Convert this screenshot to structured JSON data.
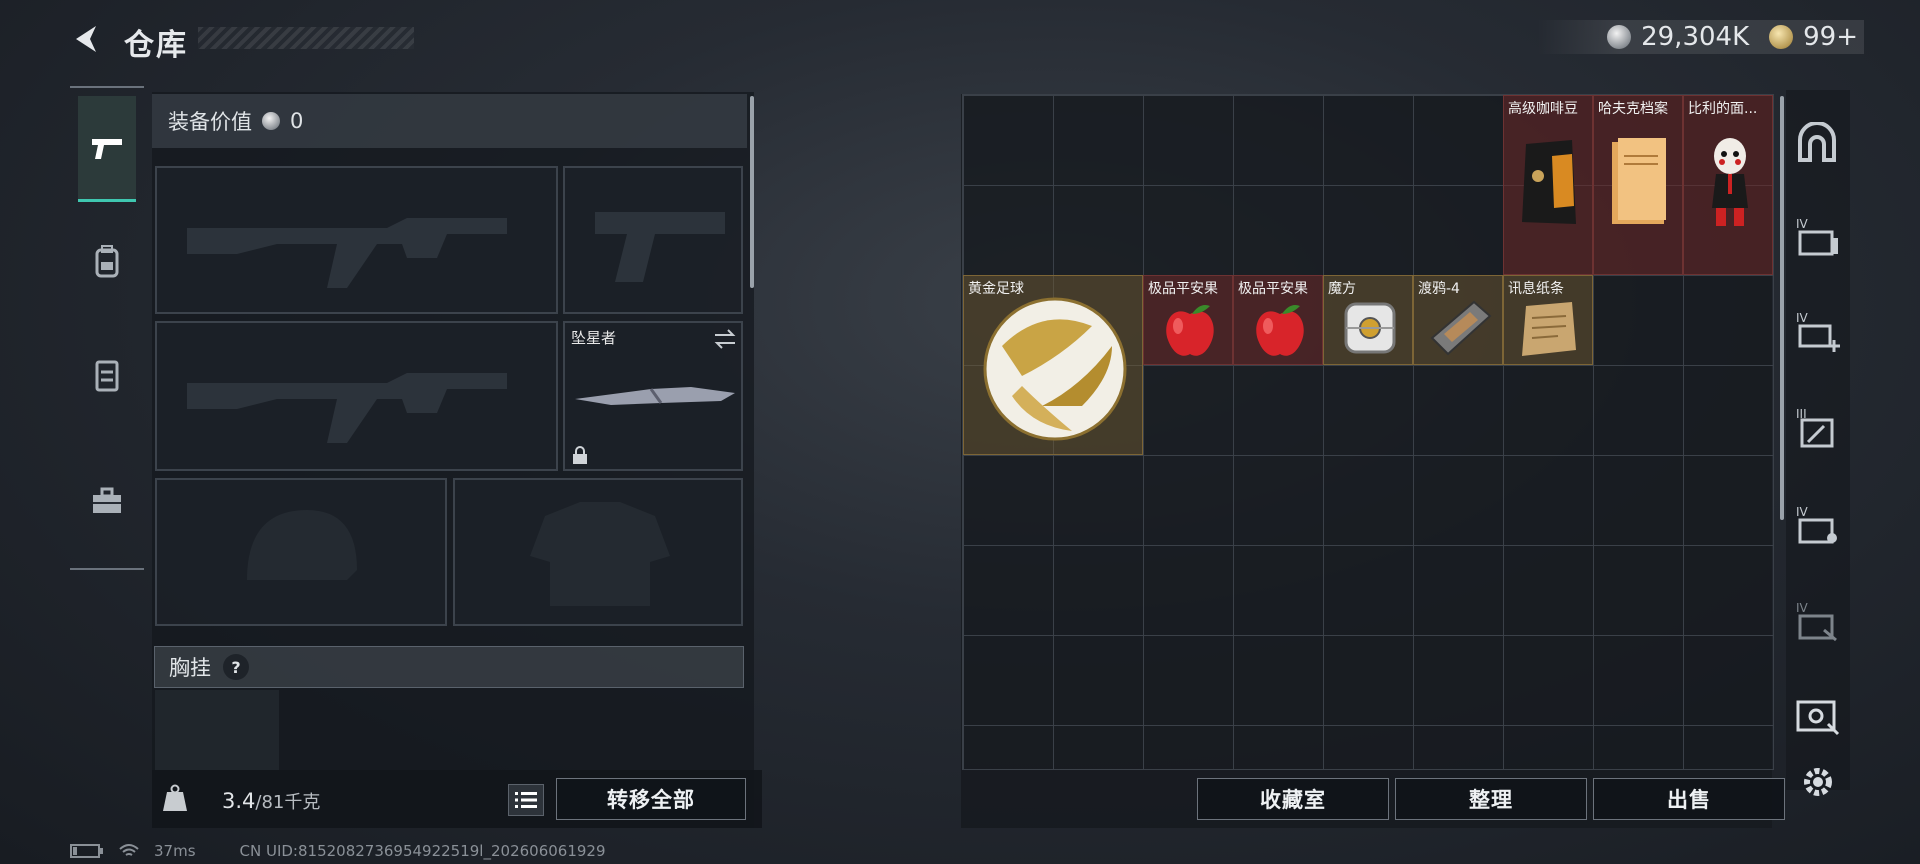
{
  "header": {
    "title": "仓库",
    "back_icon": "back-arrow-icon",
    "currency": [
      {
        "icon": "silver-coin-icon",
        "value": "29,304K"
      },
      {
        "icon": "gold-coin-icon",
        "value": "99+"
      }
    ]
  },
  "rail": {
    "items": [
      {
        "icon": "pistol-icon",
        "active": true
      },
      {
        "icon": "backpack-icon",
        "active": false
      },
      {
        "icon": "vest-icon",
        "active": false
      },
      {
        "icon": "toolbox-icon",
        "active": false
      }
    ]
  },
  "equipment": {
    "value_label": "装备价值",
    "value": "0",
    "melee_name": "坠星者",
    "chest_label": "胸挂",
    "chest_help": "?",
    "weight_current": "3.4",
    "weight_max": "/81千克",
    "transfer_all": "转移全部"
  },
  "stash": {
    "items": [
      {
        "name": "高级咖啡豆",
        "rarity": "red",
        "icon": "coffee-bag-icon"
      },
      {
        "name": "哈夫克档案",
        "rarity": "red",
        "icon": "folder-icon"
      },
      {
        "name": "比利的面...",
        "rarity": "red",
        "icon": "puppet-icon"
      },
      {
        "name": "黄金足球",
        "rarity": "gold",
        "icon": "golden-football-icon"
      },
      {
        "name": "极品平安果",
        "rarity": "red",
        "icon": "apple-icon"
      },
      {
        "name": "极品平安果",
        "rarity": "red",
        "icon": "apple-icon"
      },
      {
        "name": "魔方",
        "rarity": "gold",
        "icon": "cube-icon"
      },
      {
        "name": "渡鸦-4",
        "rarity": "gold",
        "icon": "tape-icon"
      },
      {
        "name": "讯息纸条",
        "rarity": "gold",
        "icon": "note-icon"
      }
    ],
    "buttons": {
      "collection": "收藏室",
      "sort": "整理",
      "sell": "出售"
    }
  },
  "right_rail": {
    "icons": [
      "stash-arch-icon",
      "tier-iv-crate-icon",
      "tier-iv-add-icon",
      "tier-iii-box-icon",
      "tier-iv-box-icon",
      "tier-iv-case-icon",
      "ticket-icon",
      "settings-gear-icon"
    ]
  },
  "status_bar": {
    "ping": "37ms",
    "uid": "CN UID:8152082736954922519l_202606061929"
  }
}
